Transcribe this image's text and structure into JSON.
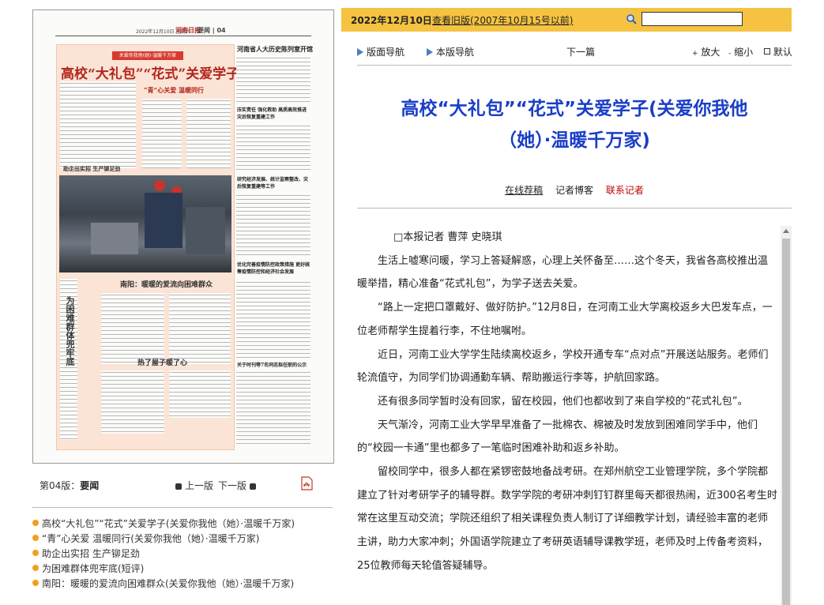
{
  "thumbnail": {
    "masthead_left": "2022年12月10日 星期六",
    "masthead_logo": "河南日报",
    "masthead_section": "要闻 | 04",
    "feature_banner": "关爱你我他(她)·温暖千万家",
    "feature_title": "高校“大礼包”“花式”关爱学子",
    "feature_sub1": "“青”心关爱 温暖同行",
    "feature_photo_caption": "助企出实招 生产铆足劲",
    "feature_side_title": "为困难群体兜牢底",
    "feature_bottom_title1": "南阳：暖暖的爱流向困难群众",
    "feature_bottom_title2": "热了屋子暖了心",
    "right_head1": "河南省人大历史陈列室开馆",
    "right_head2": "压实责任 强化救助 高质高效推进灾后恢复重建工作",
    "right_head3": "研究经济发展、统计监察整改、灾后恢复重建等工作",
    "right_head4": "优化完善疫情防控政策措施 更好统筹疫情防控和经济社会发展",
    "right_head5": "关于时刊等7名同志拟任职的公示"
  },
  "edition": {
    "label_prefix": "第04版：",
    "label_name": "要闻",
    "prev_label": "上一版",
    "next_label": "下一版",
    "pdf_icon": "pdf-icon"
  },
  "article_list": [
    "高校“大礼包”“花式”关爱学子(关爱你我他（她）·温暖千万家)",
    "“青”心关爱 温暖同行(关爱你我他（她）·温暖千万家)",
    "助企出实招 生产铆足劲",
    "为困难群体兜牢底(短评)",
    "南阳：暖暖的爱流向困难群众(关爱你我他（她）·温暖千万家)"
  ],
  "top_bar": {
    "date": "2022年12月10日",
    "old_edition_link": "查看旧版(2007年10月15号以前)",
    "search_placeholder": "",
    "search_icon": "search-icon",
    "bg_color": "#f5c341"
  },
  "nav": {
    "page_nav": "版面导航",
    "section_nav": "本版导航",
    "next_article": "下一篇",
    "zoom_in": "放大",
    "zoom_out": "缩小",
    "default": "默认",
    "arrow_color": "#4a7fc1"
  },
  "article": {
    "title_line1": "高校“大礼包”“花式”关爱学子(关爱你我他",
    "title_line2": "（她）·温暖千万家)",
    "title_color": "#1a3ec8",
    "byline_recommend": "在线荐稿",
    "byline_blog": "记者博客",
    "byline_contact": "联系记者",
    "contact_color": "#c00000",
    "paragraphs": [
      "□本报记者 曹萍 史晓琪",
      "生活上嘘寒问暖，学习上答疑解惑，心理上关怀备至……这个冬天，我省各高校推出温暖举措，精心准备“花式礼包”，为学子送去关爱。",
      "“路上一定把口罩戴好、做好防护。”12月8日，在河南工业大学离校返乡大巴发车点，一位老师帮学生提着行李，不住地嘱咐。",
      "近日，河南工业大学学生陆续离校返乡，学校开通专车“点对点”开展送站服务。老师们轮流值守，为同学们协调通勤车辆、帮助搬运行李等，护航回家路。",
      "还有很多同学暂时没有回家，留在校园，他们也都收到了来自学校的“花式礼包”。",
      "天气渐冷，河南工业大学早早准备了一批棉衣、棉被及时发放到困难同学手中，他们的“校园一卡通”里也都多了一笔临时困难补助和返乡补助。",
      "留校同学中，很多人都在紧锣密鼓地备战考研。在郑州航空工业管理学院，多个学院都建立了针对考研学子的辅导群。数学学院的考研冲刺钉钉群里每天都很热闹，近300名考生时常在这里互动交流；学院还组织了相关课程负责人制订了详细教学计划，请经验丰富的老师主讲，助力大家冲刺；外国语学院建立了考研英语辅导课教学班，老师及时上传备考资料，25位教师每天轮值答疑辅导。"
    ]
  }
}
